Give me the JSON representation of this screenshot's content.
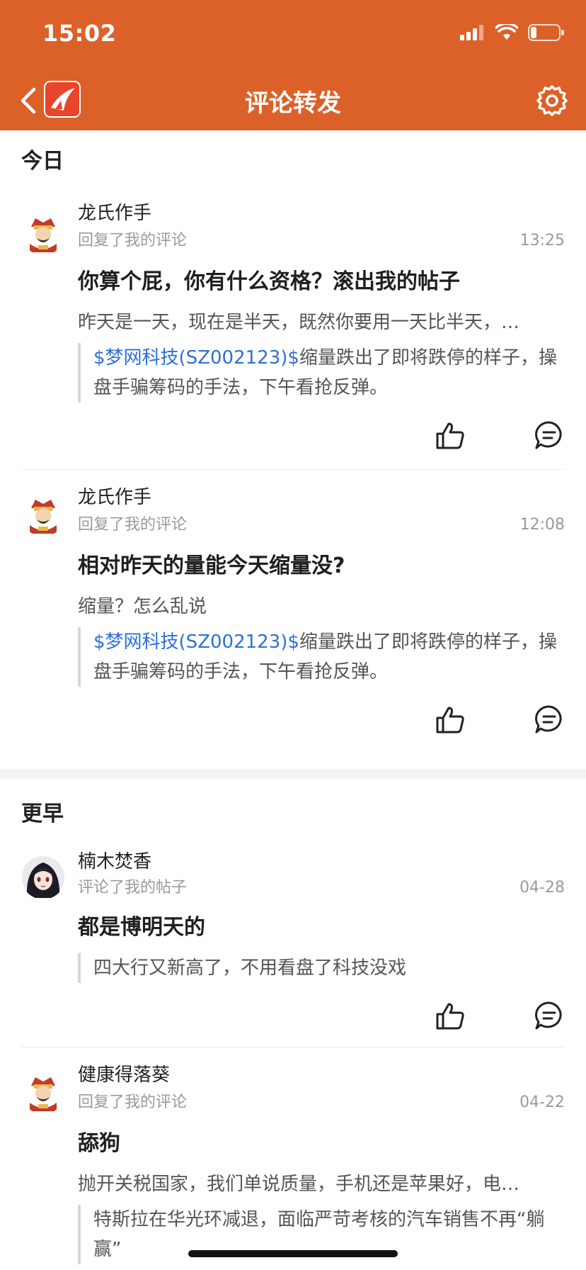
{
  "status": {
    "time": "15:02"
  },
  "nav": {
    "title": "评论转发"
  },
  "sections": [
    {
      "header": "今日"
    },
    {
      "header": "更早"
    }
  ],
  "items": [
    {
      "user": "龙氏作手",
      "action": "回复了我的评论",
      "time": "13:25",
      "title": "你算个屁，你有什么资格？滚出我的帖子",
      "reply": "昨天是一天，现在是半天，既然你要用一天比半天，…",
      "quote_link": "$梦网科技(SZ002123)$",
      "quote_text": "缩量跌出了即将跌停的样子，操盘手骗筹码的手法，下午看抢反弹。"
    },
    {
      "user": "龙氏作手",
      "action": "回复了我的评论",
      "time": "12:08",
      "title": "相对昨天的量能今天缩量没?",
      "reply": "缩量？怎么乱说",
      "quote_link": "$梦网科技(SZ002123)$",
      "quote_text": "缩量跌出了即将跌停的样子，操盘手骗筹码的手法，下午看抢反弹。"
    },
    {
      "user": "楠木焚香",
      "action": "评论了我的帖子",
      "time": "04-28",
      "title": "都是博明天的",
      "quote_text": "四大行又新高了，不用看盘了科技没戏"
    },
    {
      "user": "健康得落葵",
      "action": "回复了我的评论",
      "time": "04-22",
      "title": "舔狗",
      "reply": "抛开关税国家，我们单说质量，手机还是苹果好，电…",
      "quote_text": "特斯拉在华光环减退，面临严苛考核的汽车销售不再“躺赢”"
    }
  ],
  "colors": {
    "accent": "#dc6128",
    "link": "#2e6fd6"
  }
}
